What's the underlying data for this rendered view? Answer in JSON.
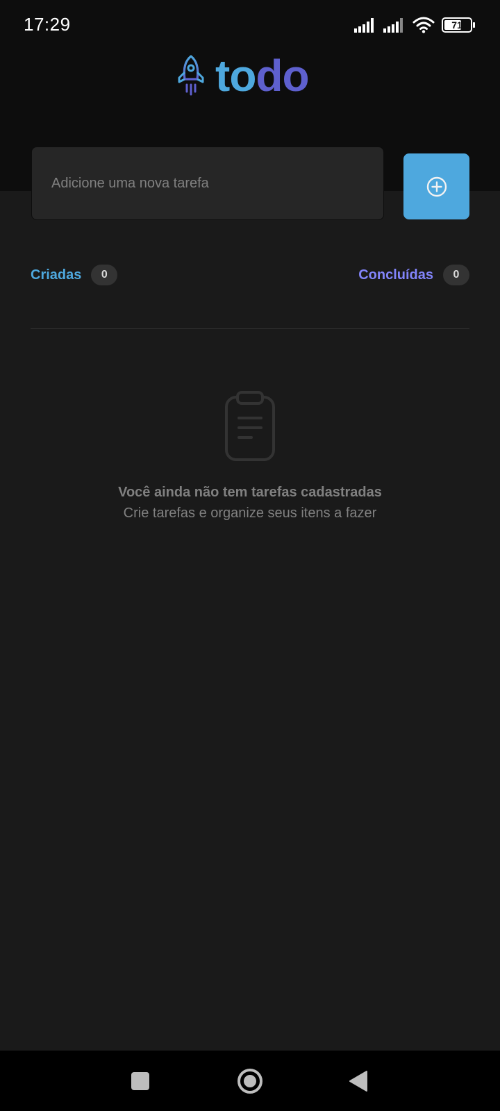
{
  "status_bar": {
    "time": "17:29",
    "battery_level": "71",
    "icons": [
      "signal-icon",
      "signal-icon",
      "wifi-icon",
      "battery-icon"
    ]
  },
  "logo": {
    "text_part1": "to",
    "text_part2": "do",
    "icon": "rocket-icon"
  },
  "new_task": {
    "value": "",
    "placeholder": "Adicione uma nova tarefa",
    "button_icon": "plus-circle-icon"
  },
  "counters": {
    "created_label": "Criadas",
    "created_count": "0",
    "done_label": "Concluídas",
    "done_count": "0"
  },
  "empty_state": {
    "icon": "clipboard-icon",
    "title": "Você ainda não tem tarefas cadastradas",
    "subtitle": "Crie tarefas e organize seus itens a fazer"
  },
  "nav_bar": {
    "icons": [
      "recents-icon",
      "home-icon",
      "back-icon"
    ]
  },
  "colors": {
    "primary_blue": "#4ea8de",
    "primary_purple": "#5e60ce",
    "purple_light": "#8284fa",
    "background": "#1a1a1a",
    "header_background": "#0d0d0d",
    "input_background": "#262626",
    "muted_text": "#808080"
  }
}
